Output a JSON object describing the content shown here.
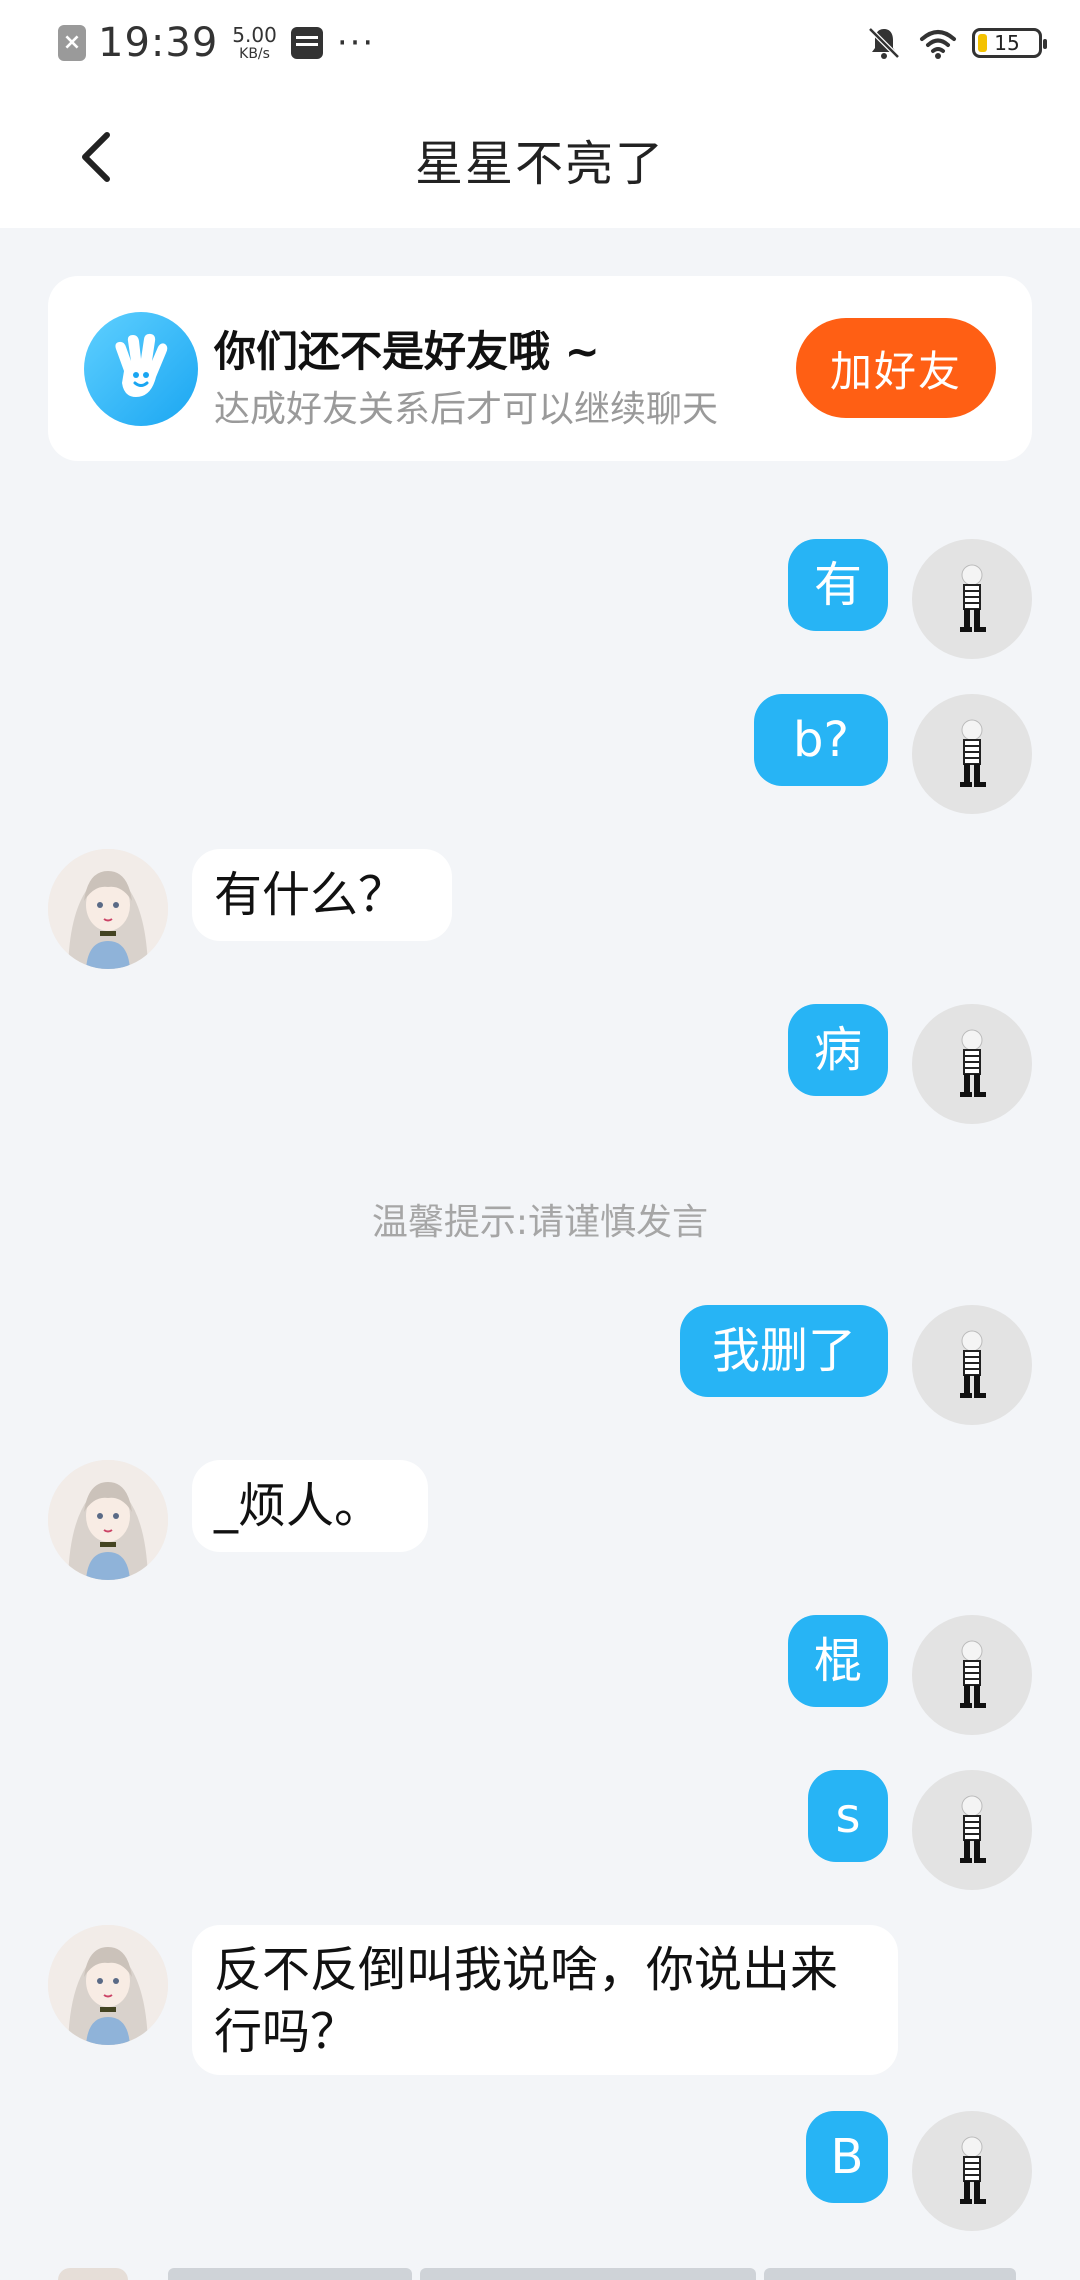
{
  "status_bar": {
    "time": "19:39",
    "net_speed_value": "5.00",
    "net_speed_unit": "KB/s",
    "more_label": "···",
    "battery_level": "15",
    "battery_fraction": 0.15,
    "battery_color": "#f4c200",
    "icons": [
      "notification-icon",
      "sim-card-icon",
      "silent-bell-icon",
      "wifi-icon",
      "battery-icon"
    ]
  },
  "header": {
    "title": "星星不亮了",
    "back_icon": "chevron-left-icon"
  },
  "friend_notice": {
    "title": "你们还不是好友哦 ~",
    "subtitle": "达成好友关系后才可以继续聊天",
    "button_label": "加好友",
    "icon": "waving-hand-icon",
    "accent_color": "#ff5f14"
  },
  "messages": [
    {
      "from": "self",
      "text": "有"
    },
    {
      "from": "self",
      "text": "b?"
    },
    {
      "from": "other",
      "text": "有什么？"
    },
    {
      "from": "self",
      "text": "病"
    },
    {
      "from": "system",
      "text": "温馨提示:请谨慎发言"
    },
    {
      "from": "self",
      "text": "我删了"
    },
    {
      "from": "other",
      "text": "_烦人。"
    },
    {
      "from": "self",
      "text": "棍"
    },
    {
      "from": "self",
      "text": "s"
    },
    {
      "from": "other",
      "text": " 反不反倒叫我说啥，你说出来行吗？"
    },
    {
      "from": "self",
      "text": "B"
    }
  ],
  "colors": {
    "self_bubble": "#27b4f5",
    "other_bubble": "#ffffff",
    "background": "#f3f5f8"
  }
}
